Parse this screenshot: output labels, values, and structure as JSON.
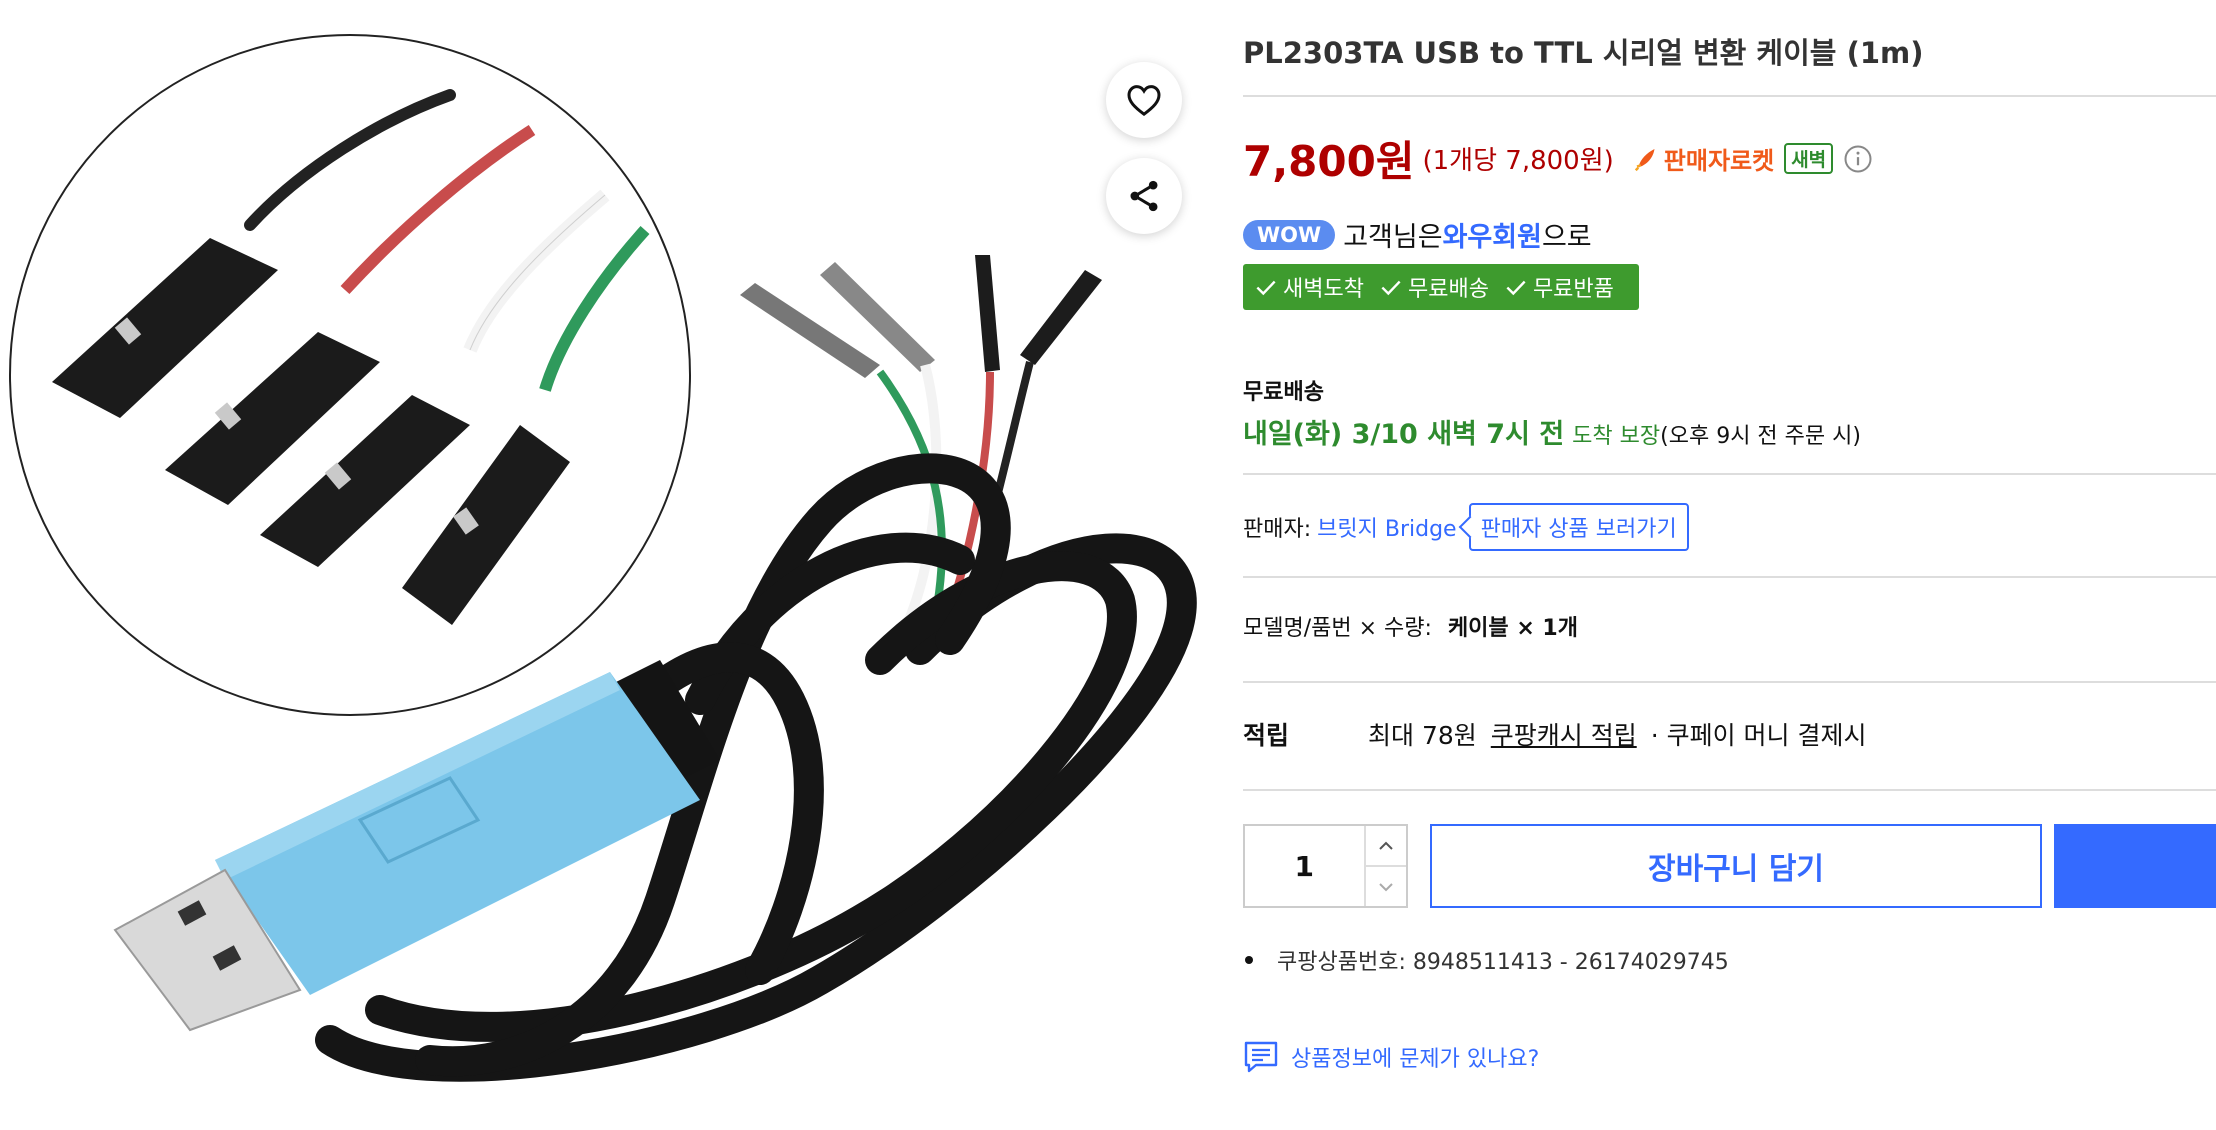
{
  "product": {
    "title": "PL2303TA USB to TTL 시리얼 변환 케이블 (1m)"
  },
  "actions": {
    "wishlist_icon": "heart-icon",
    "share_icon": "share-icon"
  },
  "price": {
    "amount": "7,800원",
    "unit_price": "(1개당 7,800원)",
    "rocket_label": "판매자로켓",
    "dawn_badge": "새벽"
  },
  "membership": {
    "wow_badge": "WOW",
    "text_prefix": "고객님은",
    "link": "와우회원",
    "text_suffix": "으로"
  },
  "benefits": [
    "새벽도착",
    "무료배송",
    "무료반품"
  ],
  "shipping": {
    "label": "무료배송",
    "date": "내일(화) 3/10 새벽 7시 전",
    "guarantee": "도착 보장",
    "cutoff": "(오후 9시 전 주문 시)"
  },
  "seller": {
    "label": "판매자:",
    "name": "브릿지 Bridge",
    "button_label": "판매자 상품 보러가기"
  },
  "option": {
    "label": "모델명/품번 × 수량:",
    "value": "케이블 × 1개"
  },
  "reward": {
    "label": "적립",
    "amount": "최대 78원",
    "link": "쿠팡캐시 적립",
    "note": "· 쿠페이 머니 결제시"
  },
  "purchase": {
    "quantity": "1",
    "cart_label": "장바구니 담기"
  },
  "details": {
    "product_number": "쿠팡상품번호: 8948511413 - 26174029745"
  },
  "report": {
    "label": "상품정보에 문제가 있나요?"
  },
  "colors": {
    "price_red": "#ae0000",
    "accent_blue": "#346aff",
    "benefit_green": "#3e9b2e",
    "rocket_orange": "#f05a1a",
    "usb_blue": "#7cc6ea"
  }
}
